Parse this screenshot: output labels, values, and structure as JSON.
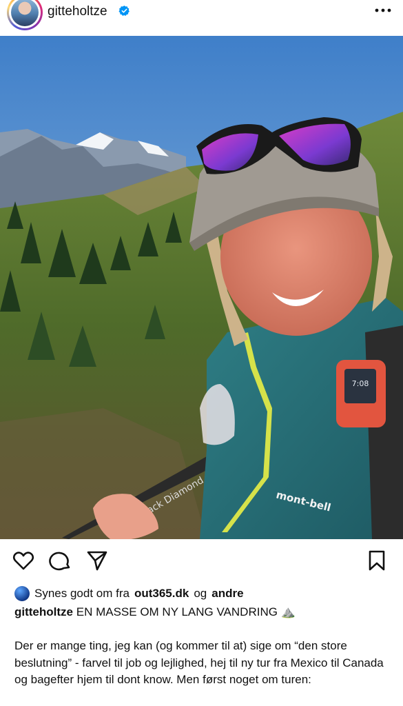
{
  "header": {
    "username": "gitteholtze",
    "verified_icon": "verified-badge-icon",
    "more_icon": "more-dots-icon"
  },
  "post": {
    "image_alt": "selfie-hiker-mountains",
    "jacket_brand": "mont-bell",
    "pole_brand": "Black Diamond",
    "device_time": "7:08"
  },
  "actions": {
    "like_icon": "heart-icon",
    "comment_icon": "comment-icon",
    "share_icon": "send-icon",
    "save_icon": "bookmark-icon"
  },
  "likes": {
    "prefix": "Synes godt om fra",
    "liker": "out365.dk",
    "middle": "og",
    "others": "andre"
  },
  "caption": {
    "username": "gitteholtze",
    "text": "EN MASSE OM NY LANG VANDRING",
    "emoji": "⛰️"
  },
  "body": {
    "text": "Der er mange ting, jeg kan (og kommer til at) sige om “den store beslutning” - farvel til job og lejlighed, hej til ny tur fra Mexico til Canada og bagefter hjem til dont know. Men først noget om turen:"
  },
  "colors": {
    "verified": "#0095f6",
    "text": "#111111"
  }
}
